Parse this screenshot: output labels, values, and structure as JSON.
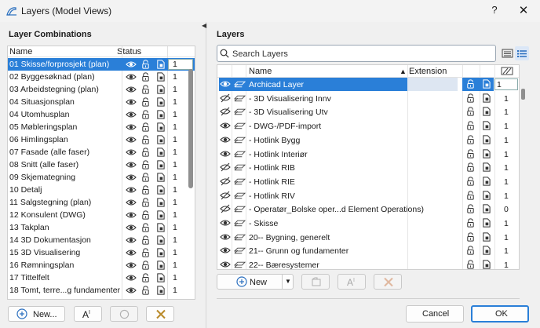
{
  "window": {
    "title": "Layers (Model Views)",
    "help": "?",
    "close": "✕"
  },
  "layer_combinations": {
    "heading": "Layer Combinations",
    "col_name": "Name",
    "col_status": "Status",
    "rows": [
      {
        "name": "01 Skisse/forprosjekt (plan)",
        "count": "1",
        "selected": true
      },
      {
        "name": "02 Byggesøknad (plan)",
        "count": "1"
      },
      {
        "name": "03 Arbeidstegning (plan)",
        "count": "1"
      },
      {
        "name": "04 Situasjonsplan",
        "count": "1"
      },
      {
        "name": "04 Utomhusplan",
        "count": "1"
      },
      {
        "name": "05 Møbleringsplan",
        "count": "1"
      },
      {
        "name": "06 Himlingsplan",
        "count": "1"
      },
      {
        "name": "07 Fasade (alle faser)",
        "count": "1"
      },
      {
        "name": "08 Snitt (alle faser)",
        "count": "1"
      },
      {
        "name": "09 Skjemategning",
        "count": "1"
      },
      {
        "name": "10 Detalj",
        "count": "1"
      },
      {
        "name": "11 Salgstegning (plan)",
        "count": "1"
      },
      {
        "name": "12 Konsulent (DWG)",
        "count": "1"
      },
      {
        "name": "13 Takplan",
        "count": "1"
      },
      {
        "name": "14 3D Dokumentasjon",
        "count": "1"
      },
      {
        "name": "15 3D Visualisering",
        "count": "1"
      },
      {
        "name": "16 Rømningsplan",
        "count": "1"
      },
      {
        "name": "17 Tittelfelt",
        "count": "1"
      },
      {
        "name": "18 Tomt, terre...g fundamenter",
        "count": "1"
      }
    ],
    "buttons": {
      "new": "New..."
    }
  },
  "layers": {
    "heading": "Layers",
    "search_placeholder": "Search Layers",
    "col_name": "Name",
    "col_extension": "Extension",
    "rows": [
      {
        "name": "Archicad Layer",
        "count": "1",
        "selected": true,
        "visible": true
      },
      {
        "name": "- 3D Visualisering Innv",
        "count": "1",
        "visible": false
      },
      {
        "name": "- 3D Visualisering Utv",
        "count": "1",
        "visible": false
      },
      {
        "name": "- DWG-/PDF-import",
        "count": "1",
        "visible": true
      },
      {
        "name": "- Hotlink Bygg",
        "count": "1",
        "visible": true
      },
      {
        "name": "- Hotlink Interiør",
        "count": "1",
        "visible": true
      },
      {
        "name": "- Hotlink RIB",
        "count": "1",
        "visible": false
      },
      {
        "name": "- Hotlink RIE",
        "count": "1",
        "visible": false
      },
      {
        "name": "- Hotlink RIV",
        "count": "1",
        "visible": false
      },
      {
        "name": "- Operatør_Bolske oper...d Element Operations)",
        "count": "0",
        "visible": false
      },
      {
        "name": "- Skisse",
        "count": "1",
        "visible": true
      },
      {
        "name": "20-- Bygning, generelt",
        "count": "1",
        "visible": true
      },
      {
        "name": "21-- Grunn og fundamenter",
        "count": "1",
        "visible": true
      },
      {
        "name": "22-- Bæresystemer",
        "count": "1",
        "visible": true
      }
    ],
    "buttons": {
      "new": "New"
    }
  },
  "footer": {
    "cancel": "Cancel",
    "ok": "OK"
  },
  "colors": {
    "accent": "#2a7fd8",
    "selected_bg": "#2a7fd8"
  }
}
